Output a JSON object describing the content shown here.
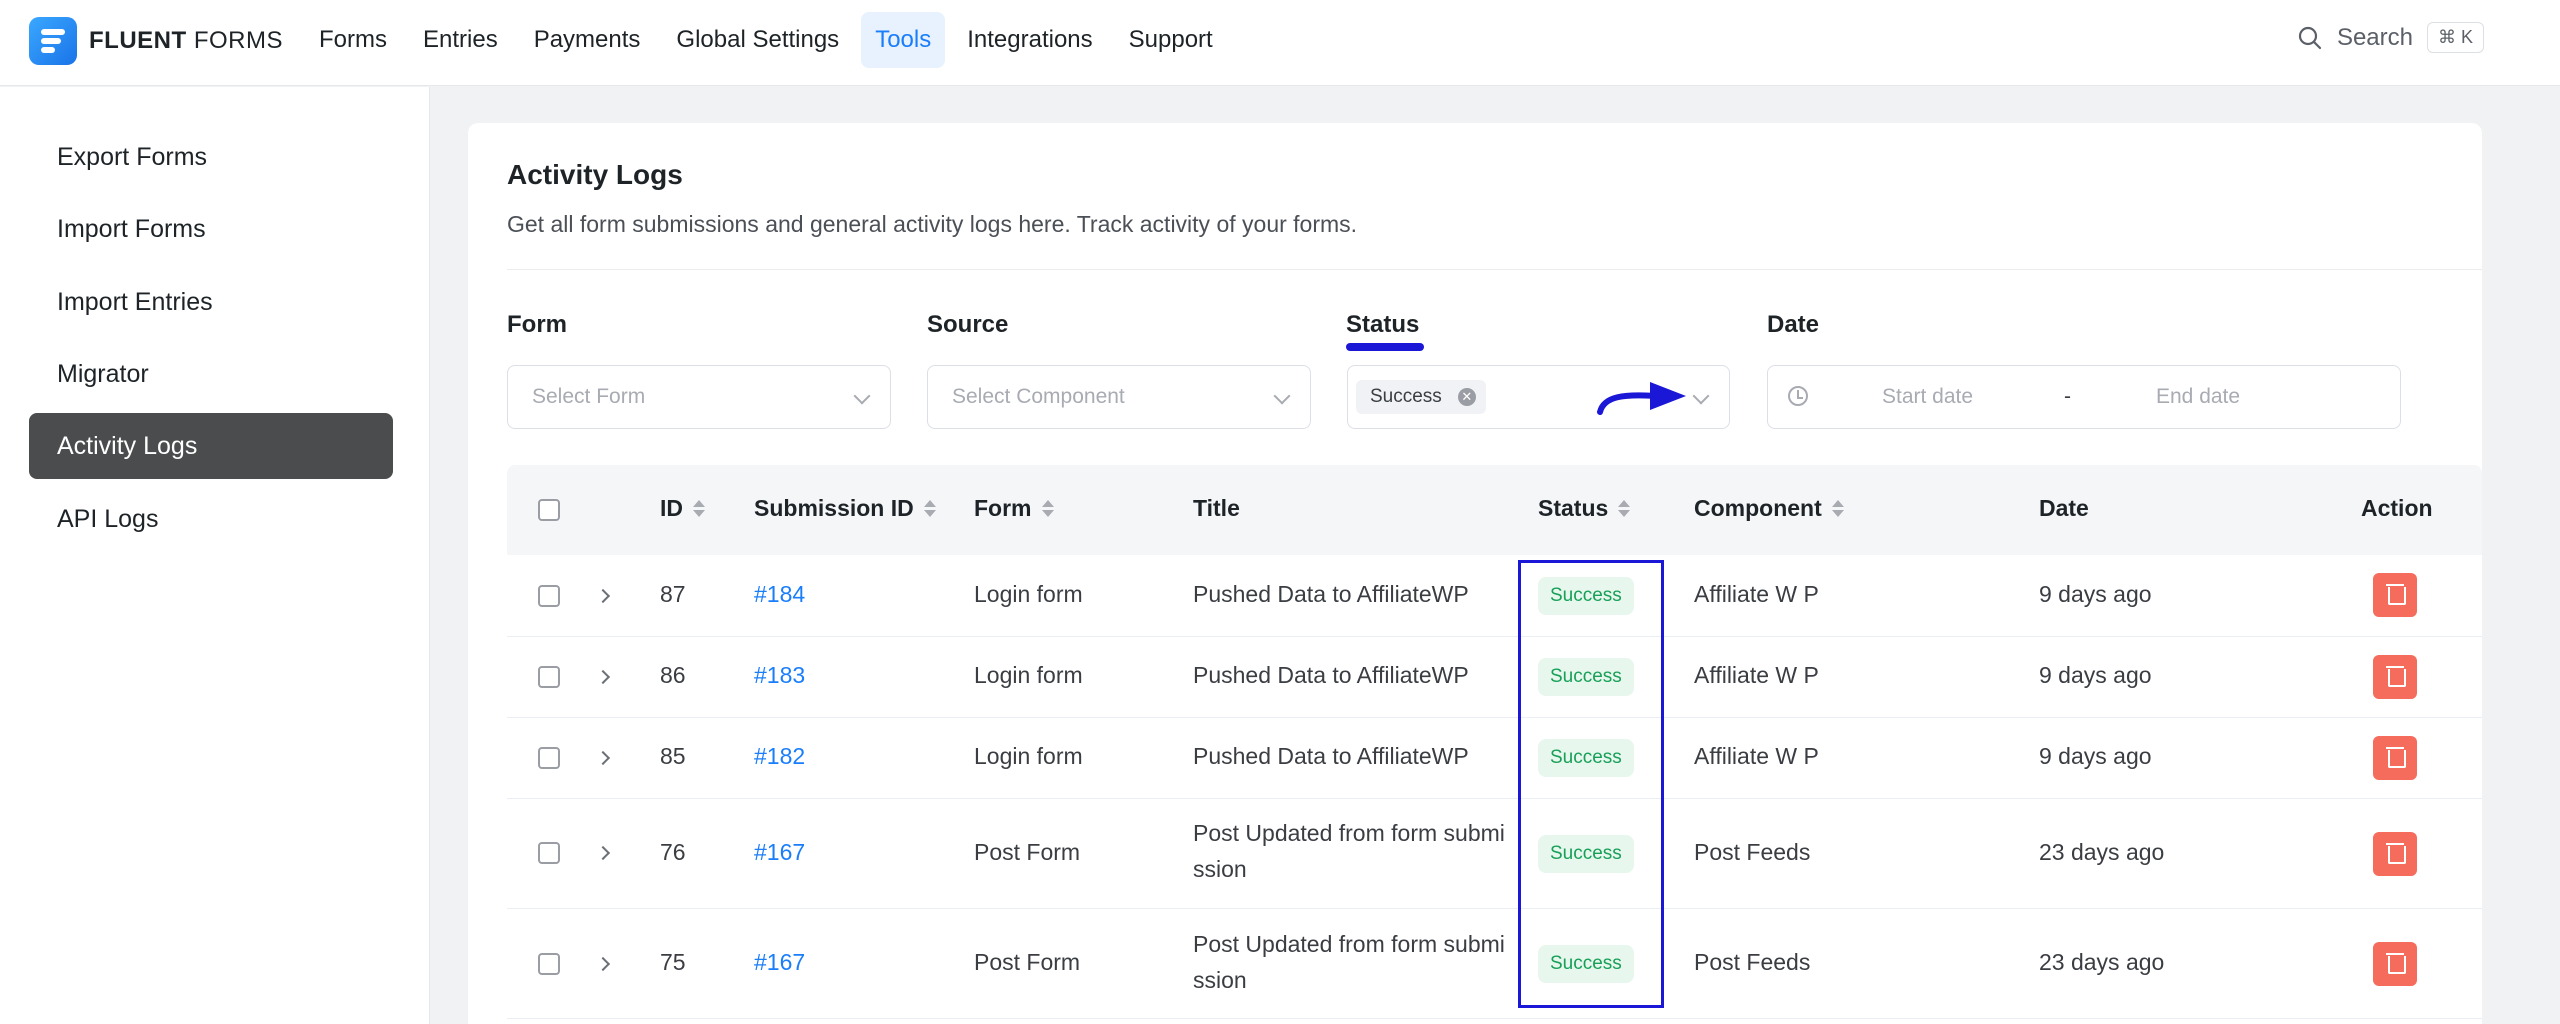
{
  "brand": {
    "bold": "FLUENT",
    "light": "FORMS"
  },
  "nav": [
    {
      "label": "Forms"
    },
    {
      "label": "Entries"
    },
    {
      "label": "Payments"
    },
    {
      "label": "Global Settings"
    },
    {
      "label": "Tools",
      "active": true
    },
    {
      "label": "Integrations"
    },
    {
      "label": "Support"
    }
  ],
  "search": {
    "label": "Search",
    "shortcut": "⌘ K"
  },
  "sidebar": [
    {
      "label": "Export Forms"
    },
    {
      "label": "Import Forms"
    },
    {
      "label": "Import Entries"
    },
    {
      "label": "Migrator"
    },
    {
      "label": "Activity Logs",
      "active": true
    },
    {
      "label": "API Logs"
    }
  ],
  "page": {
    "title": "Activity Logs",
    "description": "Get all form submissions and general activity logs here. Track activity of your forms."
  },
  "filters": {
    "form": {
      "label": "Form",
      "placeholder": "Select Form"
    },
    "source": {
      "label": "Source",
      "placeholder": "Select Component"
    },
    "status": {
      "label": "Status",
      "selected": "Success"
    },
    "date": {
      "label": "Date",
      "start_placeholder": "Start date",
      "separator": "-",
      "end_placeholder": "End date"
    }
  },
  "table": {
    "columns": {
      "id": "ID",
      "submission": "Submission ID",
      "form": "Form",
      "title": "Title",
      "status": "Status",
      "component": "Component",
      "date": "Date",
      "action": "Action"
    },
    "rows": [
      {
        "id": "87",
        "submission": "#184",
        "form": "Login form",
        "title_1": "Pushed Data to AffiliateWP",
        "title_2": "",
        "status": "Success",
        "component": "Affiliate W P",
        "date": "9 days ago"
      },
      {
        "id": "86",
        "submission": "#183",
        "form": "Login form",
        "title_1": "Pushed Data to AffiliateWP",
        "title_2": "",
        "status": "Success",
        "component": "Affiliate W P",
        "date": "9 days ago"
      },
      {
        "id": "85",
        "submission": "#182",
        "form": "Login form",
        "title_1": "Pushed Data to AffiliateWP",
        "title_2": "",
        "status": "Success",
        "component": "Affiliate W P",
        "date": "9 days ago"
      },
      {
        "id": "76",
        "submission": "#167",
        "form": "Post Form",
        "title_1": "Post Updated from form submi",
        "title_2": "ssion",
        "status": "Success",
        "component": "Post Feeds",
        "date": "23 days ago"
      },
      {
        "id": "75",
        "submission": "#167",
        "form": "Post Form",
        "title_1": "Post Updated from form submi",
        "title_2": "ssion",
        "status": "Success",
        "component": "Post Feeds",
        "date": "23 days ago"
      }
    ]
  },
  "colors": {
    "accent": "#1a7efb",
    "annotation": "#1b17d6",
    "success": "#18a058",
    "danger": "#f56c5c"
  }
}
